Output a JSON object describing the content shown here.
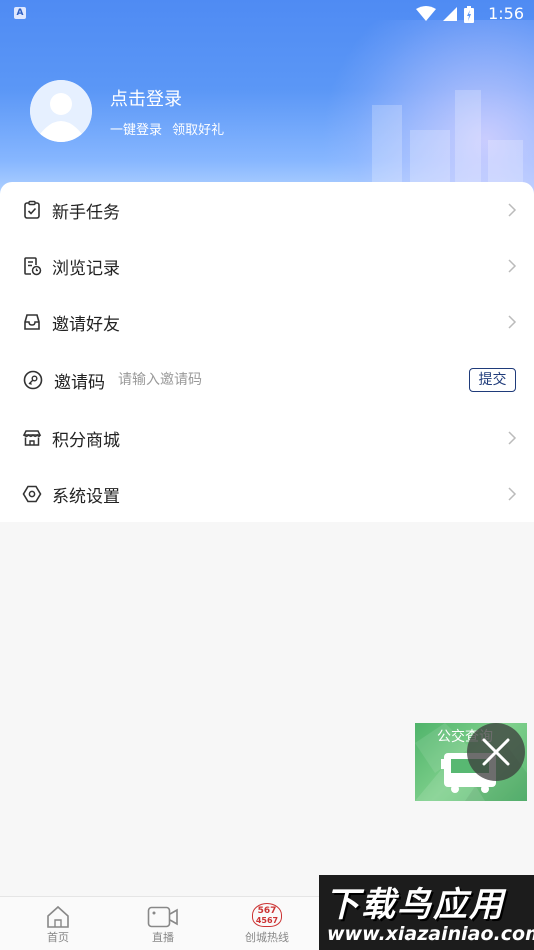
{
  "status_bar": {
    "time": "1:56",
    "app_badge": "A"
  },
  "profile": {
    "title": "点击登录",
    "subtitle": "一键登录 领取好礼"
  },
  "menu": {
    "items": [
      {
        "label": "新手任务",
        "icon": "clipboard-check-icon"
      },
      {
        "label": "浏览记录",
        "icon": "history-document-icon"
      },
      {
        "label": "邀请好友",
        "icon": "inbox-icon"
      }
    ],
    "invite_code": {
      "label": "邀请码",
      "placeholder": "请输入邀请码",
      "value": "",
      "submit_label": "提交",
      "icon": "key-icon"
    },
    "items_bottom": [
      {
        "label": "积分商城",
        "icon": "shop-icon"
      },
      {
        "label": "系统设置",
        "icon": "hexagon-settings-icon"
      }
    ]
  },
  "bus_widget": {
    "title": "公交查询"
  },
  "tabbar": {
    "tabs": [
      {
        "label": "首页",
        "icon": "home-icon"
      },
      {
        "label": "直播",
        "icon": "video-camera-icon"
      },
      {
        "label": "创城热线",
        "icon": "hotline-icon",
        "icon_text_top": "567",
        "icon_text_bottom": "4567"
      }
    ]
  },
  "watermark": {
    "title": "下载鸟应用",
    "url": "www.xiazainiao.com"
  },
  "colors": {
    "header_blue": "#4f8bf3",
    "submit_border": "#1f3b7a",
    "bus_green": "#58b872"
  }
}
